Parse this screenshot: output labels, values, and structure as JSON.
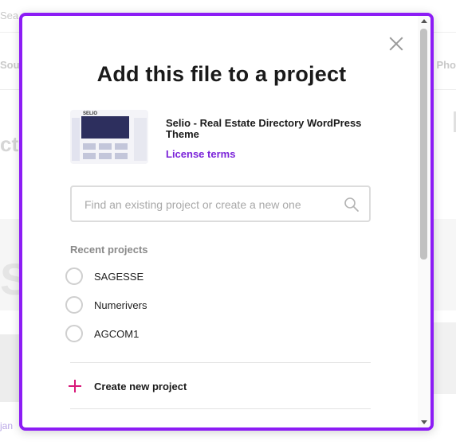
{
  "background": {
    "search_text": "Sea",
    "nav_left": "Sou",
    "nav_right": "Pho",
    "heading": "cto",
    "big_text": "SI",
    "link_text": "jan"
  },
  "modal": {
    "title": "Add this file to a project",
    "close_icon": "close-icon",
    "file": {
      "name": "Selio - Real Estate Directory WordPress Theme",
      "thumb_logo": "SELIO",
      "license_label": "License terms"
    },
    "search": {
      "placeholder": "Find an existing project or create a new one",
      "value": "",
      "icon": "search-icon"
    },
    "recent_label": "Recent projects",
    "projects": [
      {
        "name": "SAGESSE"
      },
      {
        "name": "Numerivers"
      },
      {
        "name": "AGCOM1"
      }
    ],
    "create_label": "Create new project"
  },
  "colors": {
    "accent": "#8c1cf5",
    "link": "#7b23d9",
    "plus": "#d8197a"
  }
}
